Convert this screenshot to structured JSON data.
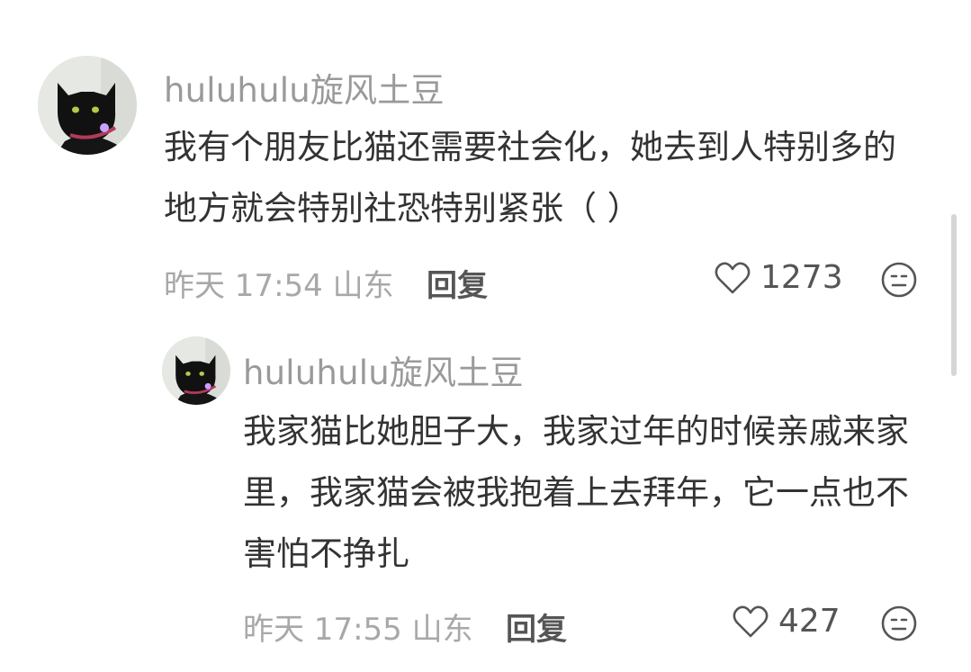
{
  "comments": [
    {
      "username": "huluhulu旋风土豆",
      "text": "我有个朋友比猫还需要社会化，她去到人特别多的地方就会特别社恐特别紧张（ ）",
      "time_location": "昨天 17:54 山东",
      "reply_label": "回复",
      "like_count": "1273"
    },
    {
      "username": "huluhulu旋风土豆",
      "text": "我家猫比她胆子大，我家过年的时候亲戚来家里，我家猫会被我抱着上去拜年，它一点也不害怕不挣扎",
      "time_location": "昨天 17:55 山东",
      "reply_label": "回复",
      "like_count": "427"
    }
  ],
  "icons": {
    "like": "heart-outline-icon",
    "reaction": "emoji-face-icon",
    "avatar": "black-cat-avatar"
  },
  "colors": {
    "username": "#9a9a9a",
    "body": "#333333",
    "meta": "#a8a8a8"
  }
}
